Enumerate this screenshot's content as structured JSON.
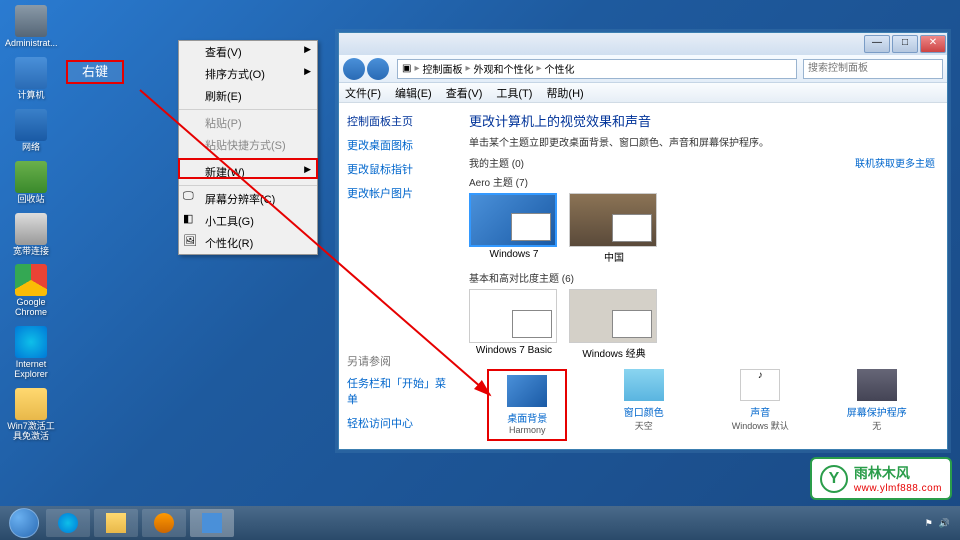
{
  "desktop": {
    "icons": [
      {
        "label": "Administrat..."
      },
      {
        "label": "计算机"
      },
      {
        "label": "网络"
      },
      {
        "label": "回收站"
      },
      {
        "label": "宽带连接"
      },
      {
        "label": "Google\nChrome"
      },
      {
        "label": "Internet\nExplorer"
      },
      {
        "label": "Win7激活工具免激活"
      }
    ]
  },
  "annotation": {
    "right_click": "右键"
  },
  "context_menu": {
    "items": [
      {
        "label": "查看(V)",
        "arrow": true
      },
      {
        "label": "排序方式(O)",
        "arrow": true
      },
      {
        "label": "刷新(E)"
      },
      {
        "sep": true
      },
      {
        "label": "粘贴(P)",
        "disabled": true
      },
      {
        "label": "粘贴快捷方式(S)",
        "disabled": true
      },
      {
        "sep": true
      },
      {
        "label": "新建(W)",
        "arrow": true
      },
      {
        "sep": true
      },
      {
        "label": "屏幕分辨率(C)",
        "icon": true
      },
      {
        "label": "小工具(G)",
        "icon": true
      },
      {
        "label": "个性化(R)",
        "icon": true
      }
    ]
  },
  "window": {
    "breadcrumb": {
      "p1": "控制面板",
      "p2": "外观和个性化",
      "p3": "个性化"
    },
    "search_placeholder": "搜索控制面板",
    "menubar": {
      "file": "文件(F)",
      "edit": "编辑(E)",
      "view": "查看(V)",
      "tools": "工具(T)",
      "help": "帮助(H)"
    },
    "sidebar": {
      "title": "控制面板主页",
      "links": [
        "更改桌面图标",
        "更改鼠标指针",
        "更改帐户图片"
      ],
      "also": "另请参阅",
      "also_links": [
        "任务栏和「开始」菜单",
        "轻松访问中心"
      ]
    },
    "main": {
      "heading": "更改计算机上的视觉效果和声音",
      "sub": "单击某个主题立即更改桌面背景、窗口颜色、声音和屏幕保护程序。",
      "my_themes": "我的主题 (0)",
      "more_link": "联机获取更多主题",
      "aero": "Aero 主题 (7)",
      "basic": "基本和高对比度主题 (6)",
      "themes": {
        "win7": "Windows 7",
        "china": "中国",
        "basic": "Windows 7 Basic",
        "classic": "Windows 经典"
      },
      "bottom": {
        "wallpaper": {
          "title": "桌面背景",
          "sub": "Harmony"
        },
        "color": {
          "title": "窗口颜色",
          "sub": "天空"
        },
        "sound": {
          "title": "声音",
          "sub": "Windows 默认"
        },
        "saver": {
          "title": "屏幕保护程序",
          "sub": "无"
        }
      }
    }
  },
  "watermark": {
    "text": "雨林木风",
    "url": "www.ylmf888.com"
  }
}
